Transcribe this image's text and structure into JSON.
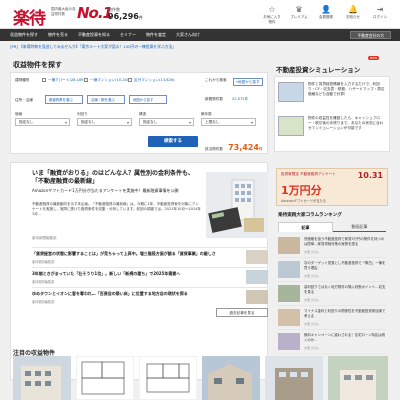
{
  "header": {
    "logo": "楽待",
    "tagline": "国内最大級の収益物件数",
    "no1": "No.1",
    "count_label": "物件数",
    "count_value": "96,296",
    "count_unit": "件",
    "icons": [
      {
        "icon": "bookmark-icon",
        "glyph": "☆",
        "label": "お気に入り物件"
      },
      {
        "icon": "crown-icon",
        "glyph": "♛",
        "label": "プレミアム"
      },
      {
        "icon": "user-icon",
        "glyph": "👤",
        "label": "会員登録"
      },
      {
        "icon": "bell-icon",
        "glyph": "🔔",
        "label": "お知らせ"
      },
      {
        "icon": "login-icon",
        "glyph": "⇥",
        "label": "ログイン"
      }
    ]
  },
  "nav": {
    "items": [
      "収益物件を探す",
      "物件を売る",
      "不動産投資を知る",
      "セミナー",
      "物件を査定",
      "大家さん向け"
    ],
    "register_label": "不動産会社の方"
  },
  "notice": "[PR] 【来場特典を見逃してみませんか】「東京ルート大家が語る！100円の一棟投資を学ぶ方法」",
  "search": {
    "title": "収益物件を探す",
    "type_label": "建物種別",
    "types": [
      "一棟アパート(28,189)",
      "一棟マンション(10,240)",
      "区分マンション(13,826)"
    ],
    "recent_label": "これから検索",
    "map_label": "地図から探す",
    "area_label": "住所・沿線",
    "area_buttons": [
      "都道府県を選ぶ",
      "沿線・駅を選ぶ",
      "地図から探す"
    ],
    "new_label": "新着物件数",
    "new_count": "22,072件",
    "filters": [
      {
        "label": "価格",
        "value": "指定なし"
      },
      {
        "label": "利回り",
        "value": "指定なし"
      },
      {
        "label": "構造",
        "value": "指定なし"
      },
      {
        "label": "築年数",
        "value": "上限なし"
      }
    ],
    "button": "検索する",
    "hits_label": "該当物件数",
    "hits_value": "73,424",
    "hits_unit": "件"
  },
  "simulation": {
    "title": "不動産投資シミュレーション",
    "badge": "NEW",
    "items": [
      {
        "text": "物件と賃貸経営情報を入力するだけで、利回り・CF・収支表・税務、ハザードマップ・周辺価格なども自動で計算！"
      },
      {
        "text": "物件の収益性を確認したら、キャッシュフロー・税引後の手残りまで、あなたの状況に合わせてシミュレーションが可能です"
      }
    ]
  },
  "articles": {
    "feature_title": "いま「融資がおりる」のはどんな人？属性別の金利条件も、「不動産融資の最新線」",
    "feature_lead": "Amazonギフトカード1万円分が当たるアンケートを実施中！最新融資事情を公開",
    "feature_body": "不動産融資の最新動向を示す本企画。「不動産融資の最前線」は、今期に1年、不動産投資家を対象にアンケートを実施し、実際に受けた融資条件を収集・分析しています。前回の調査では、2023年10月〜2024年3月…",
    "feature_meta": "楽待新聞編集部",
    "rows": [
      {
        "title": "「賃貸経営の状態に影響することは」が見ちゃって上昇中。増三階段方面が語る「賃貸事業」の厳しさ",
        "meta": "楽待新聞編集部"
      },
      {
        "title": "3年間ときがまっていた「壮そうり1位」。新しい「新規の建ち」で2025年需要へ",
        "meta": "楽待新聞編集部"
      },
      {
        "title": "ゆめタウンとイオンに客を奪われ…「百貨店の祭い床」に位置する地方店の現状を探る",
        "meta": "楽待新聞編集部"
      }
    ],
    "more": "過去記事を見る",
    "featured_label": "注目の収益物件"
  },
  "ad": {
    "line1": "投資家限定 不動産融資アンケート",
    "amount": "1万円分",
    "date": "10.31",
    "note": "Amazonギフトカードが当たる"
  },
  "columns": {
    "title": "楽待実践大家コラムランキング",
    "tabs": [
      "記事",
      "動画記事"
    ],
    "items": [
      {
        "text": "低価格を狙う不動産投資で家賃5万円の物件を持つのは簡単…家賃滞納対策の実情を語る",
        "meta": "大家コラム"
      },
      {
        "text": "次のターゲット見落とし不動産投資で「築古」一棟を買う理由",
        "meta": "大家コラム"
      },
      {
        "text": "高利回りではなく地方物件の購入判断ポイント…収支を見る",
        "meta": "大家コラム"
      },
      {
        "text": "マイナス金利と利回りの関係性を不動産投資家目線で考える",
        "meta": "大家コラム"
      },
      {
        "text": "無料キャンペーンに惑わされる！住宅ローン特区は続くのか…",
        "meta": "大家コラム"
      }
    ]
  },
  "colors": {
    "brand_red": "#c8102e",
    "nav_bg": "#333333",
    "accent_blue": "#1e63b8",
    "hits_orange": "#e85c0d"
  }
}
